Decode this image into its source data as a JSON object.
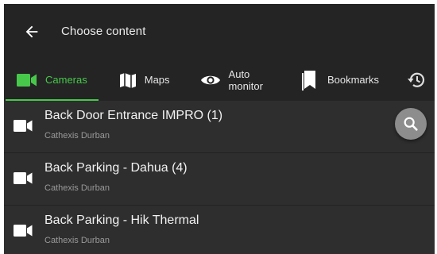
{
  "header": {
    "title": "Choose content",
    "back_icon": "arrow-left-icon"
  },
  "tabs": [
    {
      "label": "Cameras",
      "icon": "video-camera-icon",
      "active": true
    },
    {
      "label": "Maps",
      "icon": "map-icon",
      "active": false
    },
    {
      "label": "Auto monitor",
      "icon": "eye-icon",
      "active": false
    },
    {
      "label": "Bookmarks",
      "icon": "bookmark-icon",
      "active": false
    },
    {
      "label": "",
      "icon": "history-icon",
      "active": false
    }
  ],
  "list": {
    "items": [
      {
        "name": "Back Door Entrance IMPRO (1)",
        "site": "Cathexis Durban"
      },
      {
        "name": "Back Parking - Dahua (4)",
        "site": "Cathexis Durban"
      },
      {
        "name": "Back Parking - Hik Thermal",
        "site": "Cathexis Durban"
      }
    ]
  },
  "fab": {
    "icon": "search-icon"
  },
  "colors": {
    "accent": "#47c84b",
    "background": "#2b2b2b",
    "bar": "#242424"
  }
}
